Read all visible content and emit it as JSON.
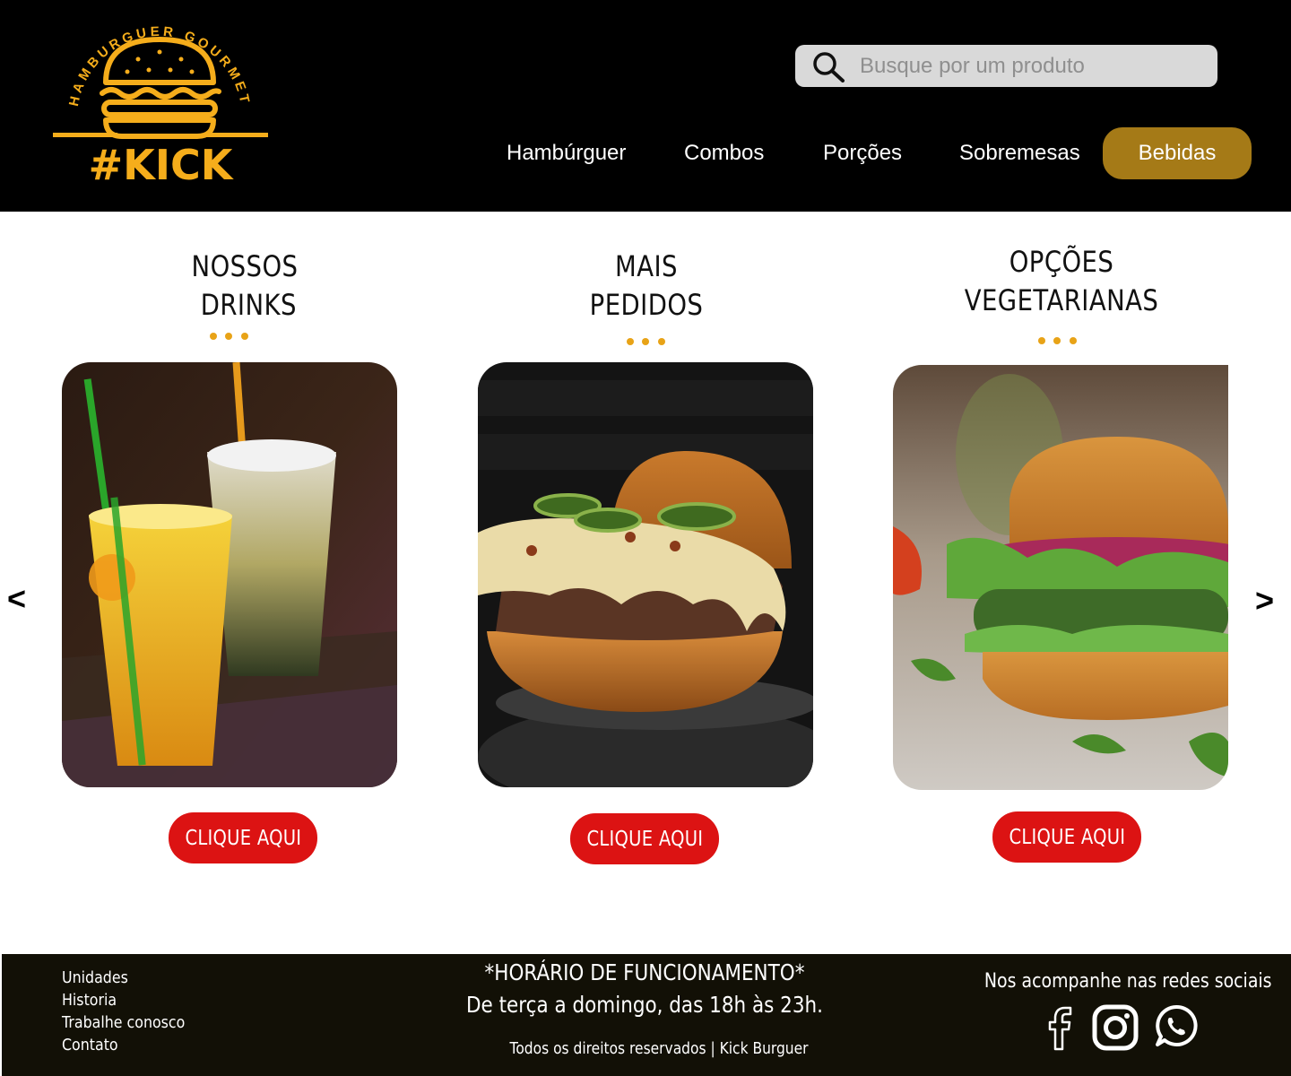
{
  "header": {
    "logo": {
      "arc_text": "HAMBURGUER GOURMET",
      "brand": "#KICK"
    },
    "search": {
      "placeholder": "Busque por um produto"
    },
    "nav": [
      {
        "label": "Hambúrguer"
      },
      {
        "label": "Combos"
      },
      {
        "label": "Porções"
      },
      {
        "label": "Sobremesas"
      },
      {
        "label": "Bebidas",
        "active": true
      }
    ]
  },
  "carousel": {
    "prev_label": "<",
    "next_label": ">",
    "categories": [
      {
        "title_line1": "NOSSOS",
        "title_line2": "DRINKS",
        "image": "drinks-photo",
        "button": "CLIQUE AQUI"
      },
      {
        "title_line1": "MAIS",
        "title_line2": "PEDIDOS",
        "image": "cheeseburger-photo",
        "button": "CLIQUE AQUI"
      },
      {
        "title_line1": "OPÇÕES",
        "title_line2": "VEGETARIANAS",
        "image": "veggie-burger-photo",
        "button": "CLIQUE AQUI"
      }
    ]
  },
  "footer": {
    "links": [
      "Unidades",
      "Historia",
      "Trabalhe conosco",
      "Contato"
    ],
    "hours_title": "*HORÁRIO DE FUNCIONAMENTO*",
    "hours_text": "De terça a domingo, das 18h às 23h.",
    "rights": "Todos os direitos reservados | Kick Burguer",
    "social_title": "Nos acompanhe nas redes sociais",
    "social_icons": [
      "facebook-icon",
      "instagram-icon",
      "whatsapp-icon"
    ]
  },
  "colors": {
    "header_bg": "#000000",
    "accent_gold": "#f5ad1b",
    "active_nav": "#a57a17",
    "cta_red": "#dc1313",
    "footer_bg": "#121006",
    "dots": "#e8a317"
  }
}
